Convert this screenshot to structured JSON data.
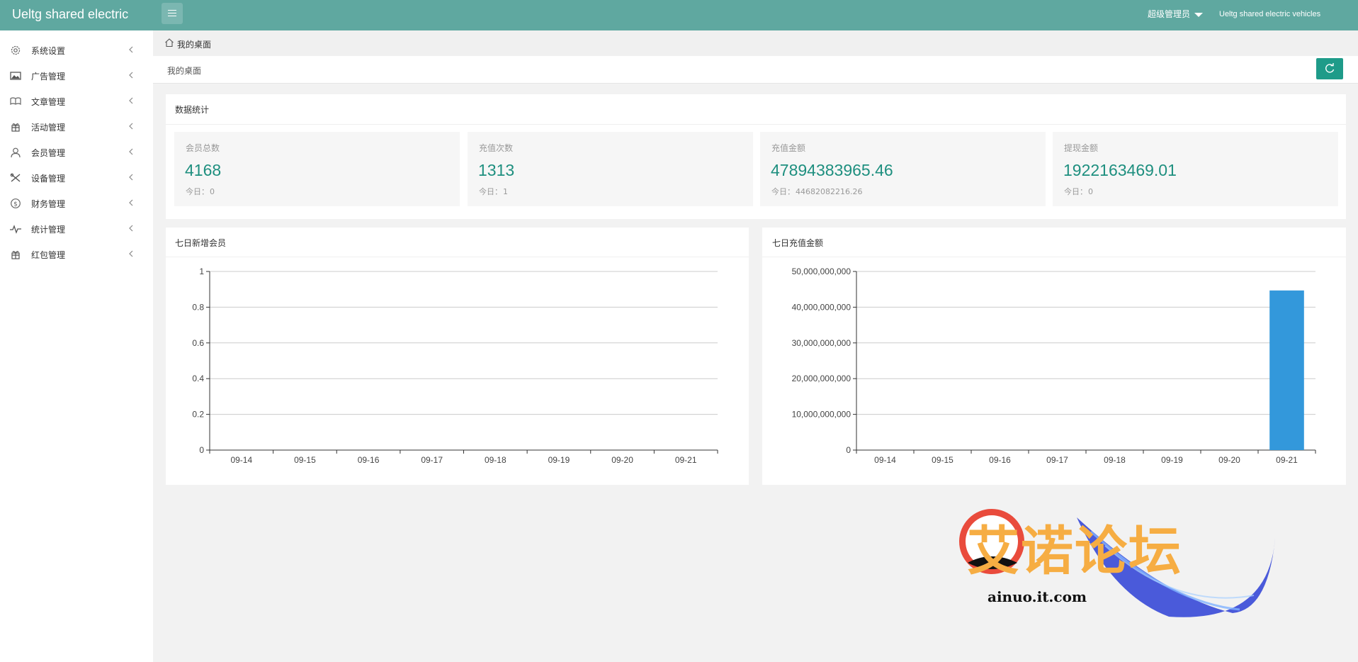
{
  "header": {
    "app_title": "Ueltg shared electric",
    "user_menu_label": "超级管理员",
    "site_link": "Ueltg shared electric vehicles"
  },
  "sidebar": {
    "items": [
      {
        "label": "系统设置",
        "icon": "gear-icon"
      },
      {
        "label": "广告管理",
        "icon": "image-icon"
      },
      {
        "label": "文章管理",
        "icon": "book-icon"
      },
      {
        "label": "活动管理",
        "icon": "gift-icon"
      },
      {
        "label": "会员管理",
        "icon": "user-icon"
      },
      {
        "label": "设备管理",
        "icon": "tools-icon"
      },
      {
        "label": "财务管理",
        "icon": "dollar-icon"
      },
      {
        "label": "统计管理",
        "icon": "pulse-icon"
      },
      {
        "label": "红包管理",
        "icon": "gift-icon"
      }
    ]
  },
  "breadcrumb": {
    "home_label": "我的桌面"
  },
  "page": {
    "title": "我的桌面"
  },
  "stats": {
    "section_title": "数据统计",
    "today_prefix": "今日：",
    "cards": [
      {
        "label": "会员总数",
        "value": "4168",
        "today": "0"
      },
      {
        "label": "充值次数",
        "value": "1313",
        "today": "1"
      },
      {
        "label": "充值金额",
        "value": "47894383965.46",
        "today": "44682082216.26"
      },
      {
        "label": "提现金额",
        "value": "1922163469.01",
        "today": "0"
      }
    ]
  },
  "chart_data": [
    {
      "type": "line",
      "title": "七日新增会员",
      "categories": [
        "09-14",
        "09-15",
        "09-16",
        "09-17",
        "09-18",
        "09-19",
        "09-20",
        "09-21"
      ],
      "values": [
        0,
        0,
        0,
        0,
        0,
        0,
        0,
        0
      ],
      "yticks": [
        "0",
        "0.2",
        "0.4",
        "0.6",
        "0.8",
        "1"
      ],
      "ylim": [
        0,
        1
      ],
      "grid": true,
      "color": "#3398db"
    },
    {
      "type": "bar",
      "title": "七日充值金额",
      "categories": [
        "09-14",
        "09-15",
        "09-16",
        "09-17",
        "09-18",
        "09-19",
        "09-20",
        "09-21"
      ],
      "values": [
        0,
        0,
        0,
        0,
        0,
        0,
        0,
        44682082216.26
      ],
      "yticks": [
        "0",
        "10,000,000,000",
        "20,000,000,000",
        "30,000,000,000",
        "40,000,000,000",
        "50,000,000,000"
      ],
      "ylim": [
        0,
        50000000000
      ],
      "grid": true,
      "color": "#3398db"
    }
  ],
  "watermark": {
    "text": "艾诺论坛",
    "url": "ainuo.it.com"
  },
  "colors": {
    "header": "#5fa8a0",
    "accent": "#1e8f7f",
    "button": "#1e9b89",
    "bar": "#3398db"
  }
}
